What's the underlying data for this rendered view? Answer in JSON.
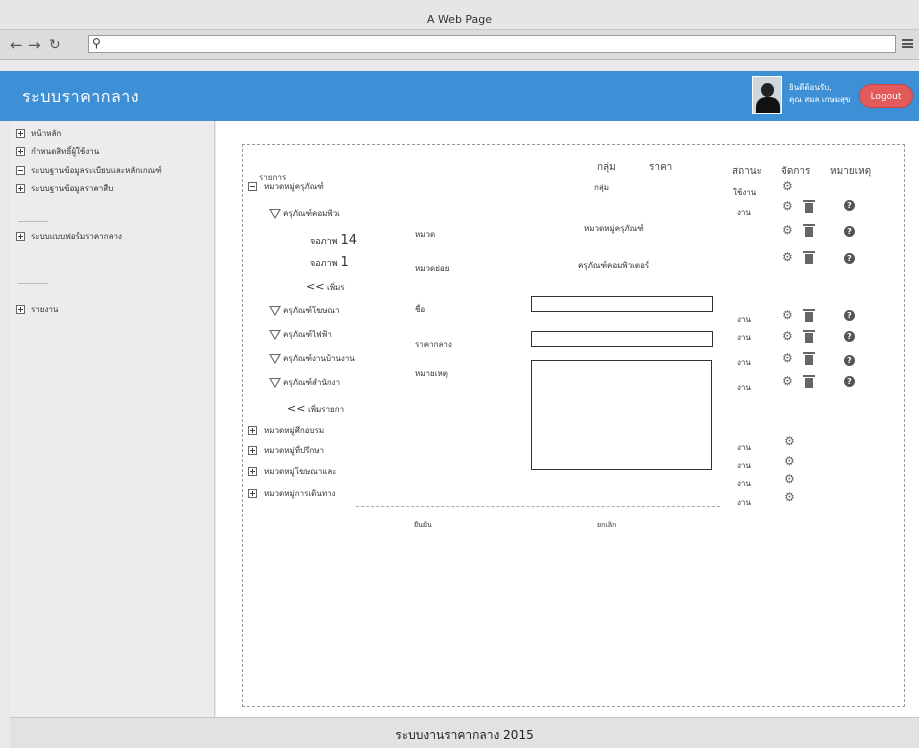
{
  "browser": {
    "title": "A Web Page",
    "back_icon": "arrow-left-icon",
    "forward_icon": "arrow-right-icon",
    "reload_icon": "reload-icon",
    "search_icon": "search-icon",
    "menu_icon": "hamburger-icon"
  },
  "header": {
    "brand": "ระบบราคากลาง",
    "greeting_line1": "ยินดีต้อนรับ,",
    "greeting_line2": "คุณ สมล เกษมสุข",
    "logout": "Logout",
    "colors": {
      "bar": "#3d8fd6",
      "logout": "#e25a5a"
    }
  },
  "sidebar": {
    "items": [
      {
        "label": "หน้าหลัก",
        "state": "plus"
      },
      {
        "label": "กำหนดสิทธิ์ผู้ใช้งาน",
        "state": "plus"
      },
      {
        "label": "ระบบฐานข้อมูลระเบียบและหลักเกณฑ์",
        "state": "minus"
      },
      {
        "label": "ระบบฐานข้อมูลราคาสืบ",
        "state": "plus"
      },
      {
        "label": "ระบบแบบฟอร์มราคากลาง",
        "state": "plus"
      },
      {
        "label": "รายงาน",
        "state": "plus"
      }
    ]
  },
  "table": {
    "col_item": "รายการ",
    "col_group": "กลุ่ม",
    "col_price": "ราคา",
    "col_status": "สถานะ",
    "col_manage": "จัดการ",
    "col_note": "หมายเหตุ",
    "group_label": "กลุ่ม",
    "status_first": "ใช้งาน",
    "status_short": "งาน",
    "rows": [
      {
        "label": "หมวดหมู่ครุภัณฑ์"
      },
      {
        "label": "ครุภัณฑ์คอมพิวเ"
      },
      {
        "label": "จอภาพ",
        "suffix": "14"
      },
      {
        "label": "จอภาพ",
        "suffix": "1"
      },
      {
        "label": "<<",
        "extra": "เพิ่มร"
      },
      {
        "label": "ครุภัณฑ์โฆษณา"
      },
      {
        "label": "ครุภัณฑ์ไฟฟ้า"
      },
      {
        "label": "ครุภัณฑ์งานบ้านงาน"
      },
      {
        "label": "ครุภัณฑ์สำนักงา"
      },
      {
        "label": "<<",
        "extra": "เพิ่มรายกา"
      },
      {
        "label": "หมวดหมู่ศึกอบรม"
      },
      {
        "label": "หมวดหมู่ที่ปรึกษา"
      },
      {
        "label": "หมวดหมู่โฆษณาและ"
      },
      {
        "label": "หมวดหมู่การเดินทาง"
      }
    ]
  },
  "form": {
    "category_label": "หมวด",
    "category_value": "หมวดหมู่ครุภัณฑ์",
    "subcategory_label": "หมวดย่อย",
    "subcategory_value": "ครุภัณฑ์คอมพิวเตอร์",
    "name_label": "ชื่อ",
    "name_value": "",
    "price_label": "ราคากลาง",
    "price_value": "",
    "note_label": "หมายเหตุ",
    "note_value": "",
    "confirm": "ยืนยัน",
    "cancel": "ยกเลิก"
  },
  "footer": {
    "text": "ระบบงานราคากลาง 2015"
  }
}
